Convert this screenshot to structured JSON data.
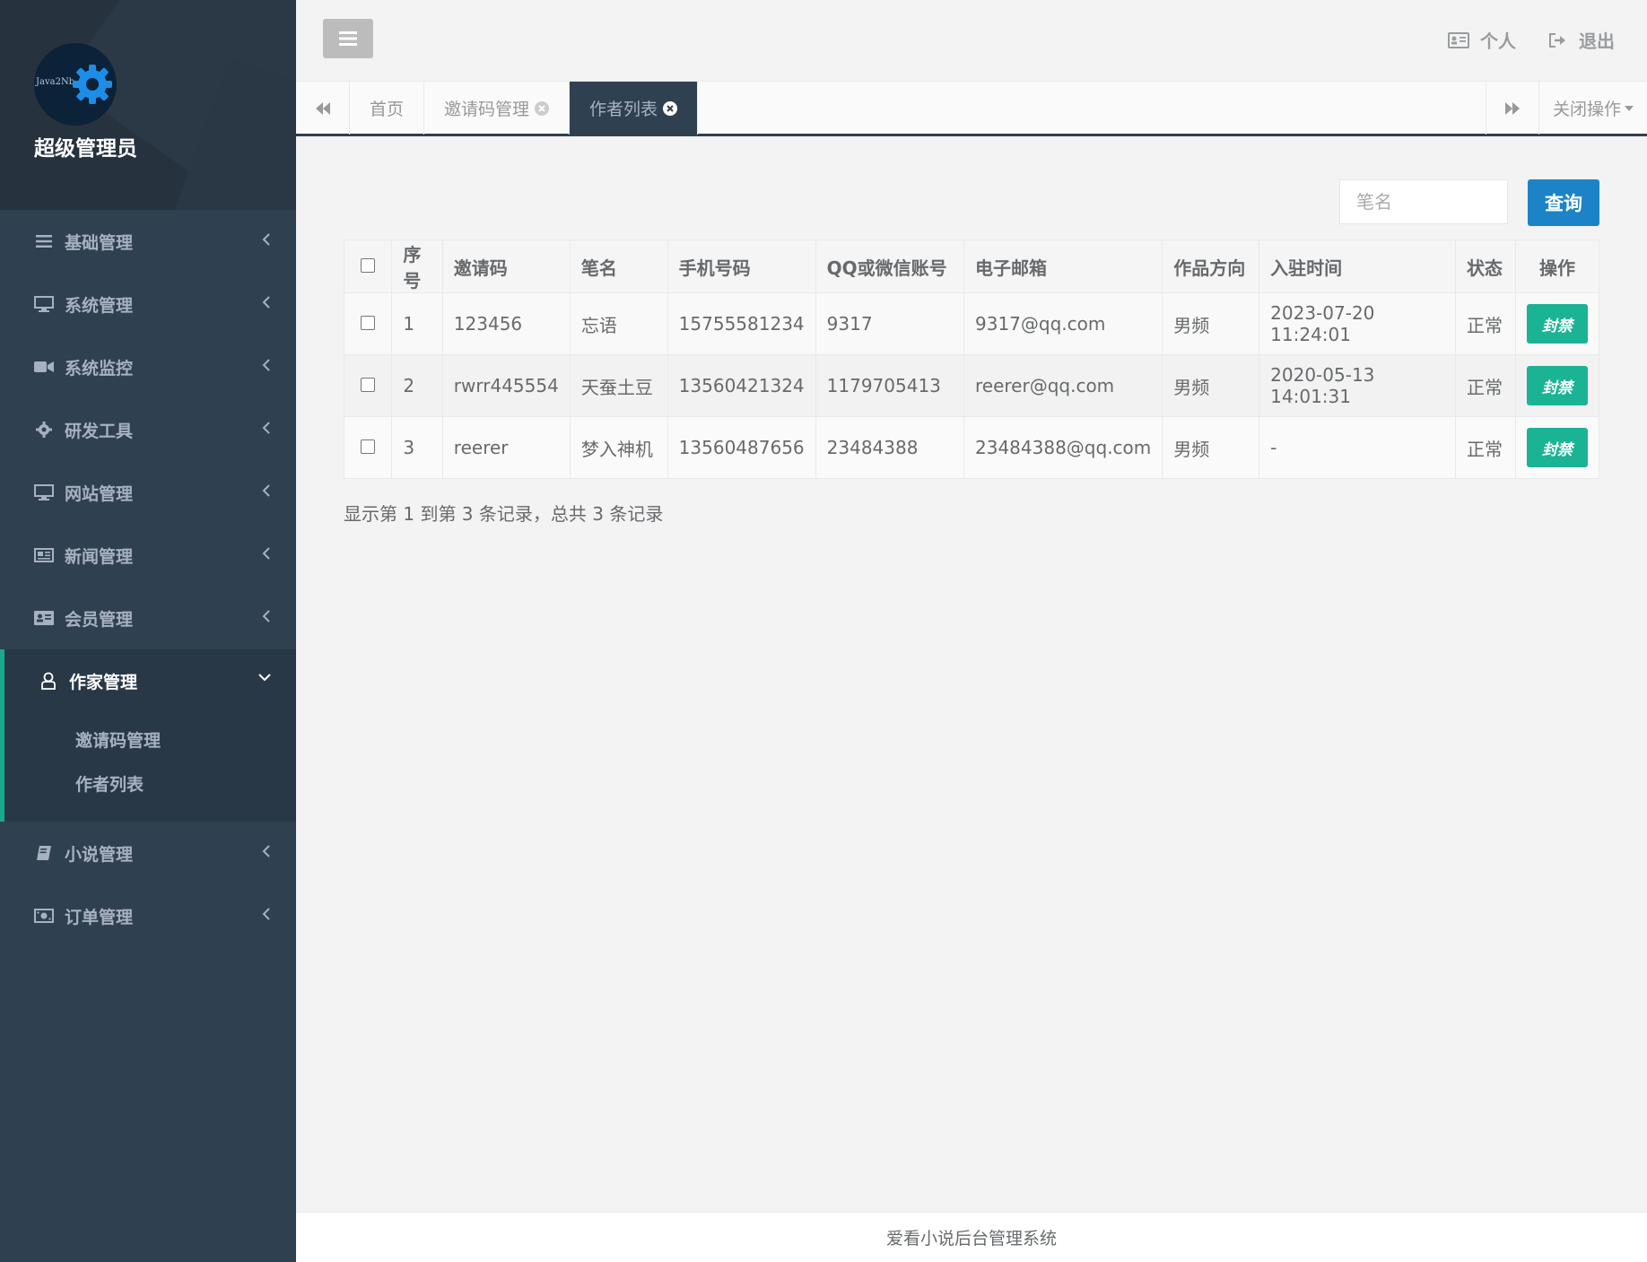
{
  "profile": {
    "brand_text": "Java2Nb",
    "name": "超级管理员"
  },
  "sidebar": {
    "items": [
      {
        "label": "基础管理",
        "icon": "bars-icon"
      },
      {
        "label": "系统管理",
        "icon": "desktop-icon"
      },
      {
        "label": "系统监控",
        "icon": "video-camera-icon"
      },
      {
        "label": "研发工具",
        "icon": "gear-icon"
      },
      {
        "label": "网站管理",
        "icon": "desktop-icon"
      },
      {
        "label": "新闻管理",
        "icon": "newspaper-icon"
      },
      {
        "label": "会员管理",
        "icon": "id-card-icon"
      },
      {
        "label": "作家管理",
        "icon": "user-icon",
        "active": true
      },
      {
        "label": "小说管理",
        "icon": "book-icon"
      },
      {
        "label": "订单管理",
        "icon": "money-icon"
      }
    ],
    "submenu": [
      {
        "label": "邀请码管理"
      },
      {
        "label": "作者列表"
      }
    ]
  },
  "topbar": {
    "personal_label": "个人",
    "logout_label": "退出"
  },
  "tabs": {
    "items": [
      {
        "label": "首页"
      },
      {
        "label": "邀请码管理"
      },
      {
        "label": "作者列表",
        "active": true
      }
    ],
    "close_ops_label": "关闭操作"
  },
  "search": {
    "placeholder": "笔名",
    "button_label": "查询"
  },
  "table": {
    "headers": [
      "序号",
      "邀请码",
      "笔名",
      "手机号码",
      "QQ或微信账号",
      "电子邮箱",
      "作品方向",
      "入驻时间",
      "状态",
      "操作"
    ],
    "rows": [
      {
        "index": "1",
        "invite_code": "123456",
        "pen_name": "忘语",
        "phone": "15755581234",
        "qq_wechat": "9317",
        "email": "9317@qq.com",
        "direction": "男频",
        "joined": "2023-07-20 11:24:01",
        "status": "正常",
        "action": "封禁"
      },
      {
        "index": "2",
        "invite_code": "rwrr445554",
        "pen_name": "天蚕土豆",
        "phone": "13560421324",
        "qq_wechat": "1179705413",
        "email": "reerer@qq.com",
        "direction": "男频",
        "joined": "2020-05-13 14:01:31",
        "status": "正常",
        "action": "封禁"
      },
      {
        "index": "3",
        "invite_code": "reerer",
        "pen_name": "梦入神机",
        "phone": "13560487656",
        "qq_wechat": "23484388",
        "email": "23484388@qq.com",
        "direction": "男频",
        "joined": "-",
        "status": "正常",
        "action": "封禁"
      }
    ]
  },
  "pagination": {
    "info": "显示第 1 到第 3 条记录，总共 3 条记录"
  },
  "footer": {
    "text": "爱看小说后台管理系统"
  },
  "colors": {
    "sidebar_bg": "#2f4050",
    "active_accent": "#19aa8d",
    "primary": "#1c84c6",
    "ban_button": "#1ab394"
  }
}
